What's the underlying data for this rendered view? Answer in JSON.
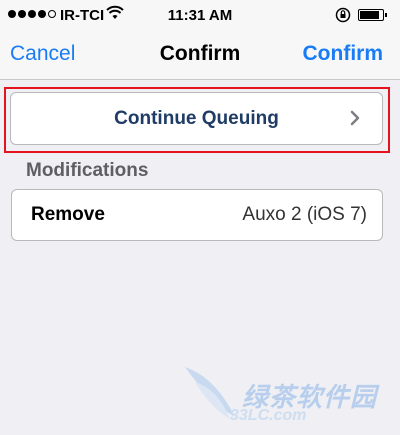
{
  "status_bar": {
    "carrier": "IR-TCI",
    "time": "11:31 AM",
    "signal_bars_filled": 4,
    "signal_bars_total": 5,
    "battery_level": 0.85,
    "icons": [
      "wifi-icon",
      "rotation-lock-icon",
      "battery-icon"
    ]
  },
  "nav": {
    "left_label": "Cancel",
    "title": "Confirm",
    "right_label": "Confirm",
    "accent_color": "#1a7cf5"
  },
  "queue_row": {
    "label": "Continue Queuing",
    "highlight_color": "#e5131d",
    "icon": "chevron-right-icon"
  },
  "modifications": {
    "header": "Modifications",
    "items": [
      {
        "action": "Remove",
        "package": "Auxo 2 (iOS 7)"
      }
    ]
  },
  "watermark": {
    "main": "绿茶软件园",
    "sub": "33LC.com"
  }
}
